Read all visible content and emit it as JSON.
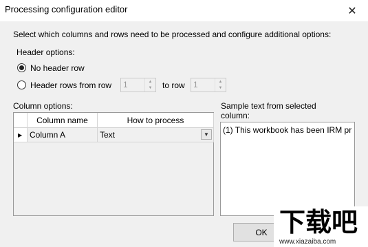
{
  "window": {
    "title": "Processing configuration editor",
    "close_glyph": "✕"
  },
  "instructions": "Select which columns and rows need to be processed and configure additional options:",
  "header_options": {
    "label": "Header options:",
    "no_header_label": "No header row",
    "header_rows_from_label": "Header rows from row",
    "from_value": "1",
    "to_label": "to row",
    "to_value": "1"
  },
  "column_options": {
    "label": "Column options:",
    "columns": [
      "Column name",
      "How to process"
    ],
    "rows": [
      {
        "name": "Column A",
        "process": "Text"
      }
    ]
  },
  "sample": {
    "label_line1": "Sample text from selected",
    "label_line2": "column:",
    "text": "(1) This workbook has been IRM pr"
  },
  "buttons": {
    "ok": "OK"
  },
  "watermark": {
    "big": "下载吧",
    "small": "www.xiazaiba.com"
  }
}
